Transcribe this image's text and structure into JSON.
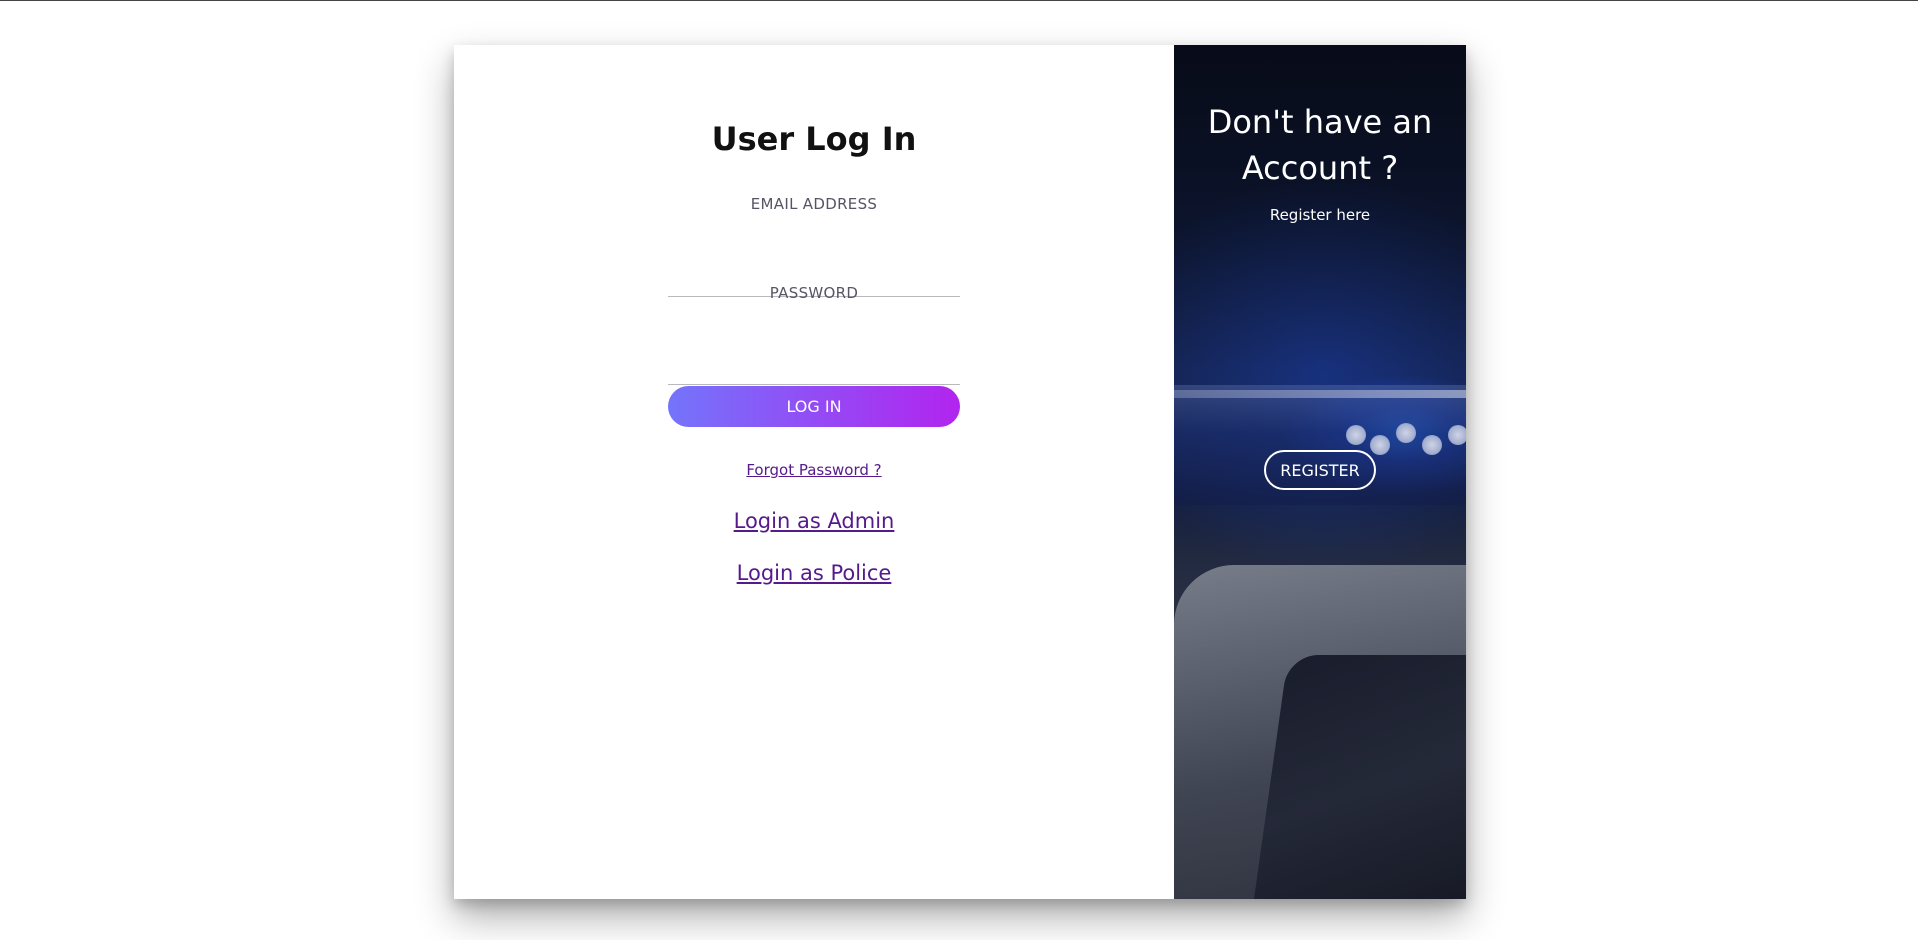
{
  "login": {
    "title": "User Log In",
    "email_label": "EMAIL ADDRESS",
    "email_value": "",
    "password_label": "PASSWORD",
    "password_value": "",
    "login_button": "LOG IN",
    "forgot_password": "Forgot Password ?",
    "login_admin": "Login as Admin",
    "login_police": "Login as Police"
  },
  "register": {
    "heading_line1": "Don't have an",
    "heading_line2": "Account ?",
    "subtitle": "Register here",
    "button": "REGISTER"
  },
  "colors": {
    "button_gradient_start": "#7474fb",
    "button_gradient_end": "#b224ef",
    "link": "#551a8b"
  }
}
